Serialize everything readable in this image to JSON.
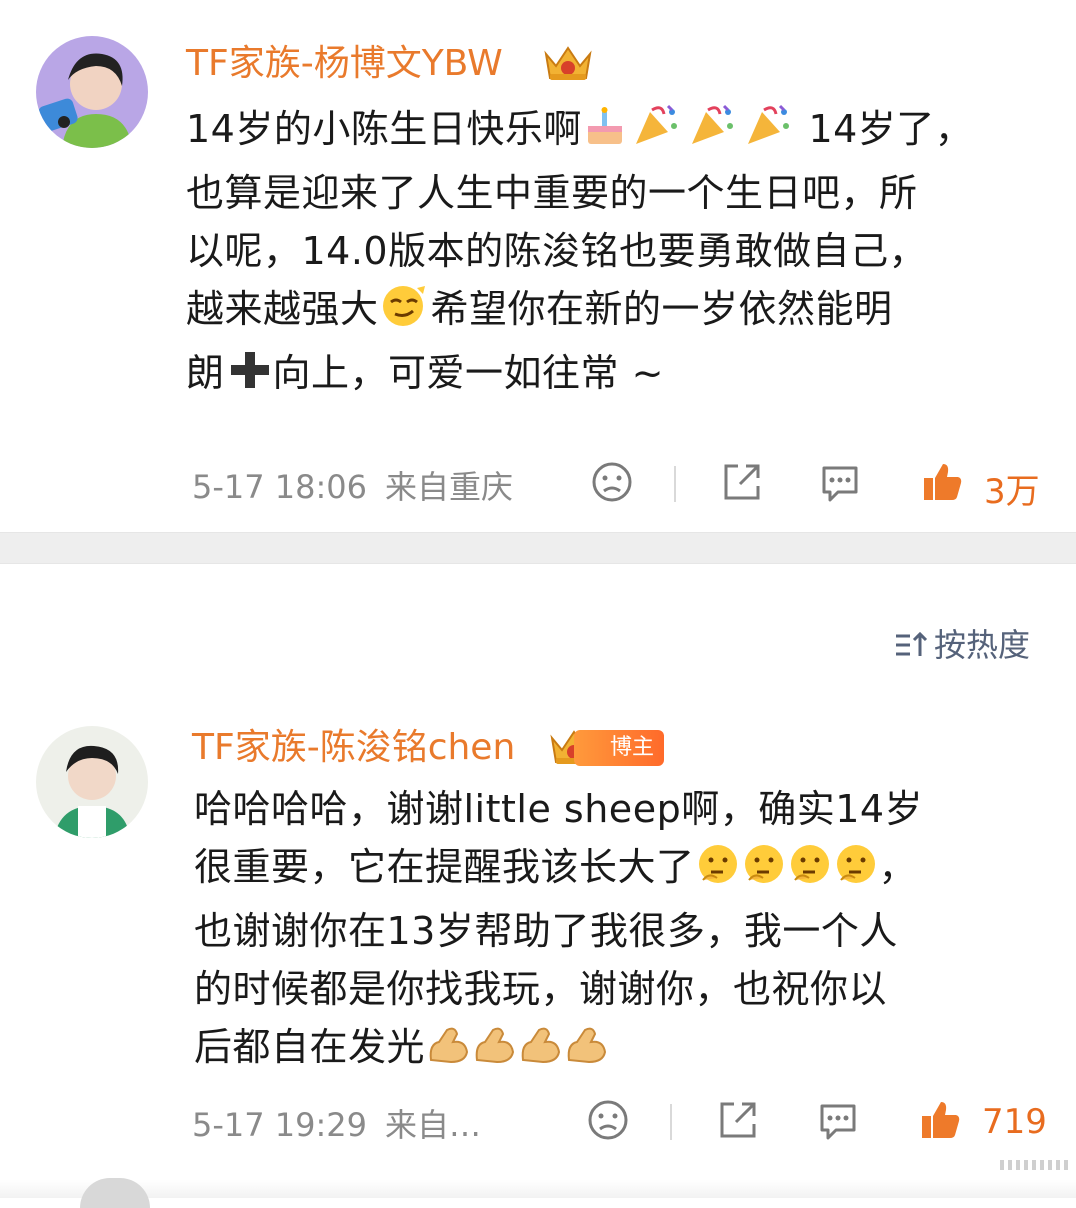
{
  "post": {
    "author": "TF家族-杨博文YBW",
    "text_lines": [
      "14岁的小陈生日快乐啊",
      "也算是迎来了人生中重要的一个生日吧，所",
      "以呢，14.0版本的陈浚铭也要勇敢做自己，",
      "越来越强大",
      "朗",
      "向上，可爱一如往常 ~"
    ],
    "line1_tail": " 14岁了，",
    "line4_tail": "希望你在新的一岁依然能明",
    "time": "5-17 18:06",
    "source": "来自重庆",
    "like_count": "3万",
    "icons": [
      "face-icon",
      "share-icon",
      "comment-icon",
      "like-icon",
      "cake-icon",
      "party-popper-icon",
      "smirk-icon",
      "plus-icon",
      "crown-icon"
    ]
  },
  "sort": {
    "label": "按热度",
    "icon": "sort-icon"
  },
  "comment": {
    "author": "TF家族-陈浚铭chen",
    "badge": "博主",
    "text_lines": [
      "哈哈哈哈，谢谢little sheep啊，确实14岁",
      "很重要，它在提醒我该长大了",
      "也谢谢你在13岁帮助了我很多，我一个人",
      "的时候都是你找我玩，谢谢你，也祝你以",
      "后都自在发光"
    ],
    "line2_tail": "，",
    "time": "5-17 19:29",
    "source": "来自…",
    "like_count": "719",
    "icons": [
      "thinking-face-icon",
      "flexed-biceps-icon"
    ]
  },
  "colors": {
    "accent": "#e97a2c",
    "like": "#e86c1f",
    "meta": "#8a8a8a",
    "divider": "#eeeeee"
  }
}
